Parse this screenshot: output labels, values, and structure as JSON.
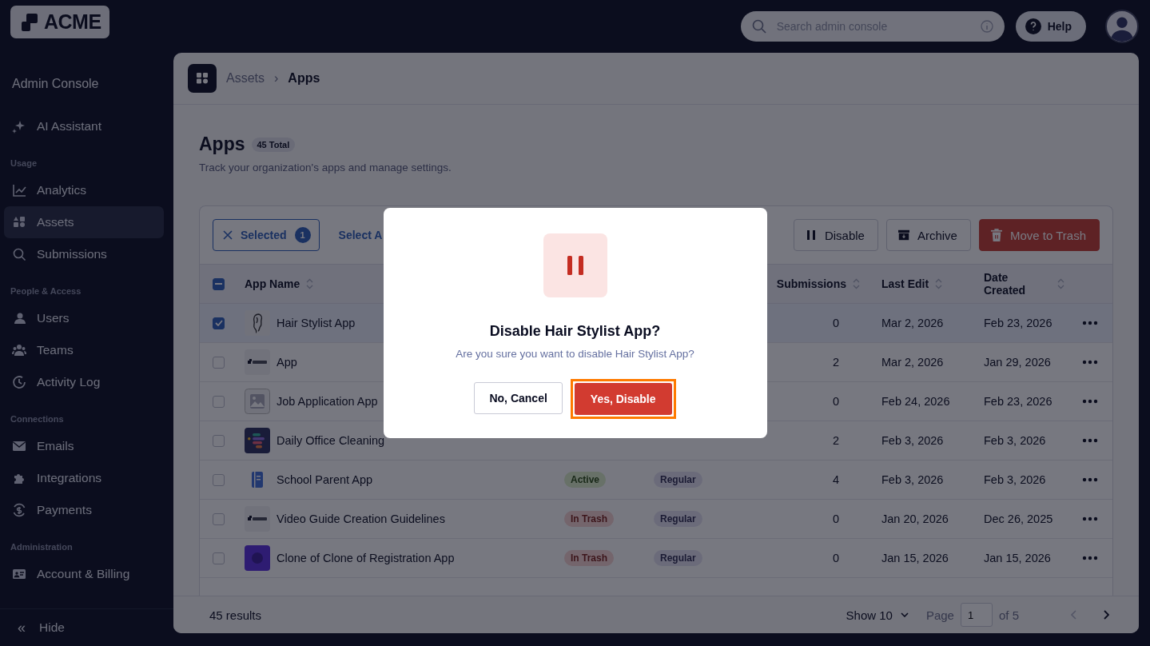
{
  "logo": "ACME",
  "search": {
    "placeholder": "Search admin console"
  },
  "help": "Help",
  "sidebar": {
    "title": "Admin Console",
    "groups": [
      {
        "items": [
          {
            "label": "AI Assistant",
            "selected": false
          }
        ]
      },
      {
        "label": "Usage",
        "items": [
          {
            "label": "Analytics",
            "selected": false
          },
          {
            "label": "Assets",
            "selected": true
          },
          {
            "label": "Submissions",
            "selected": false
          }
        ]
      },
      {
        "label": "People & Access",
        "items": [
          {
            "label": "Users",
            "selected": false
          },
          {
            "label": "Teams",
            "selected": false
          },
          {
            "label": "Activity Log",
            "selected": false
          }
        ]
      },
      {
        "label": "Connections",
        "items": [
          {
            "label": "Emails",
            "selected": false
          },
          {
            "label": "Integrations",
            "selected": false
          },
          {
            "label": "Payments",
            "selected": false
          }
        ]
      },
      {
        "label": "Administration",
        "items": [
          {
            "label": "Account & Billing",
            "selected": false
          }
        ]
      }
    ],
    "hide": {
      "icon": "«",
      "label": "Hide"
    }
  },
  "breadcrumb": {
    "items": [
      "Assets",
      "Apps"
    ],
    "separator": "›"
  },
  "page": {
    "title": "Apps",
    "total": "45 Total",
    "subtitle": "Track your organization's apps and manage settings."
  },
  "toolbar": {
    "selected_label": "Selected",
    "selected_count": "1",
    "select_all": "Select A",
    "actions": [
      {
        "label": "Disable",
        "kind": "pause"
      },
      {
        "label": "Archive",
        "kind": "archive"
      },
      {
        "label": "Move to Trash",
        "kind": "trash"
      }
    ]
  },
  "table": {
    "indeterminate": true,
    "columns": [
      "App Name",
      "Submissions",
      "Last Edit",
      "Date Created"
    ],
    "rows": [
      {
        "selected": true,
        "name": "Hair Stylist App",
        "submissions": "0",
        "last_edit": "Mar 2, 2026",
        "date_created": "Feb 23, 2026"
      },
      {
        "selected": false,
        "name": "App",
        "submissions": "2",
        "last_edit": "Mar 2, 2026",
        "date_created": "Jan 29, 2026"
      },
      {
        "selected": false,
        "name": "Job Application App",
        "submissions": "0",
        "last_edit": "Feb 24, 2026",
        "date_created": "Feb 23, 2026"
      },
      {
        "selected": false,
        "name": "Daily Office Cleaning",
        "submissions": "2",
        "last_edit": "Feb 3, 2026",
        "date_created": "Feb 3, 2026"
      },
      {
        "selected": false,
        "name": "School Parent App",
        "status": "Active",
        "type": "Regular",
        "submissions": "4",
        "last_edit": "Feb 3, 2026",
        "date_created": "Feb 3, 2026"
      },
      {
        "selected": false,
        "name": "Video Guide Creation Guidelines",
        "status": "In Trash",
        "type": "Regular",
        "submissions": "0",
        "last_edit": "Jan 20, 2026",
        "date_created": "Dec 26, 2025"
      },
      {
        "selected": false,
        "name": "Clone of Clone of Registration App",
        "status": "In Trash",
        "type": "Regular",
        "submissions": "0",
        "last_edit": "Jan 15, 2026",
        "date_created": "Jan 15, 2026"
      }
    ]
  },
  "footer": {
    "results": "45 results",
    "show": "Show 10",
    "page_label": "Page",
    "page": "1",
    "of": "of 5"
  },
  "modal": {
    "title": "Disable Hair Stylist App?",
    "message": "Are you sure you want to disable Hair Stylist App?",
    "cancel": "No, Cancel",
    "confirm": "Yes, Disable",
    "confirm_focused": true
  }
}
